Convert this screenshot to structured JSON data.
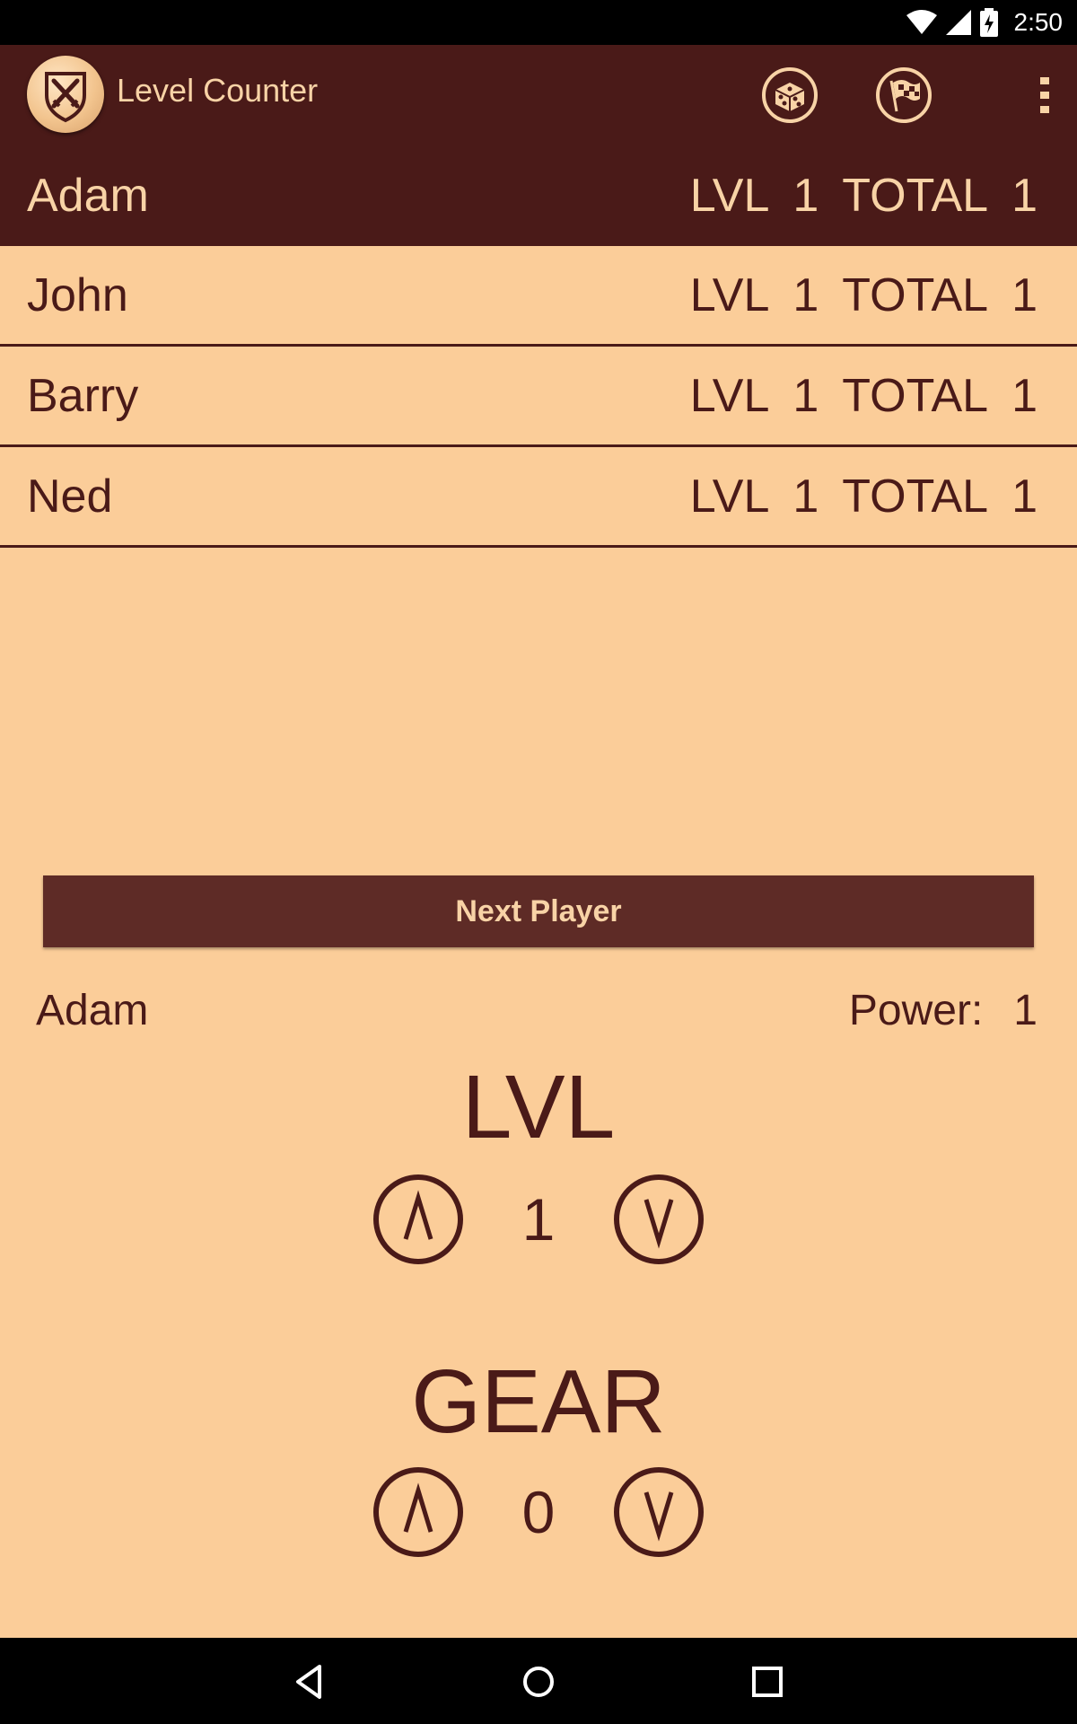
{
  "status_bar": {
    "time": "2:50",
    "icons": [
      "wifi-icon",
      "cell-signal-icon",
      "battery-charging-icon"
    ]
  },
  "app_bar": {
    "title": "Level Counter",
    "logo_icon": "shield-swords-icon",
    "actions": [
      "dice-icon",
      "checkered-flag-icon",
      "overflow-menu-icon"
    ]
  },
  "players": [
    {
      "name": "Adam",
      "lvl_label": "LVL",
      "lvl": "1",
      "total_label": "TOTAL",
      "total": "1",
      "active": true
    },
    {
      "name": "John",
      "lvl_label": "LVL",
      "lvl": "1",
      "total_label": "TOTAL",
      "total": "1",
      "active": false
    },
    {
      "name": "Barry",
      "lvl_label": "LVL",
      "lvl": "1",
      "total_label": "TOTAL",
      "total": "1",
      "active": false
    },
    {
      "name": "Ned",
      "lvl_label": "LVL",
      "lvl": "1",
      "total_label": "TOTAL",
      "total": "1",
      "active": false
    }
  ],
  "next_player_label": "Next Player",
  "current": {
    "name": "Adam",
    "power_label": "Power:",
    "power": "1"
  },
  "lvl_section": {
    "title": "LVL",
    "value": "1",
    "up_symbol": "/\\",
    "down_symbol": "\\/"
  },
  "gear_section": {
    "title": "GEAR",
    "value": "0",
    "up_symbol": "/\\",
    "down_symbol": "\\/"
  },
  "nav": [
    "back-icon",
    "home-icon",
    "recents-icon"
  ],
  "colors": {
    "background": "#FBCD99",
    "dark": "#4A1A18",
    "button": "#5E2B26",
    "accent_text": "#F8D3A6"
  }
}
